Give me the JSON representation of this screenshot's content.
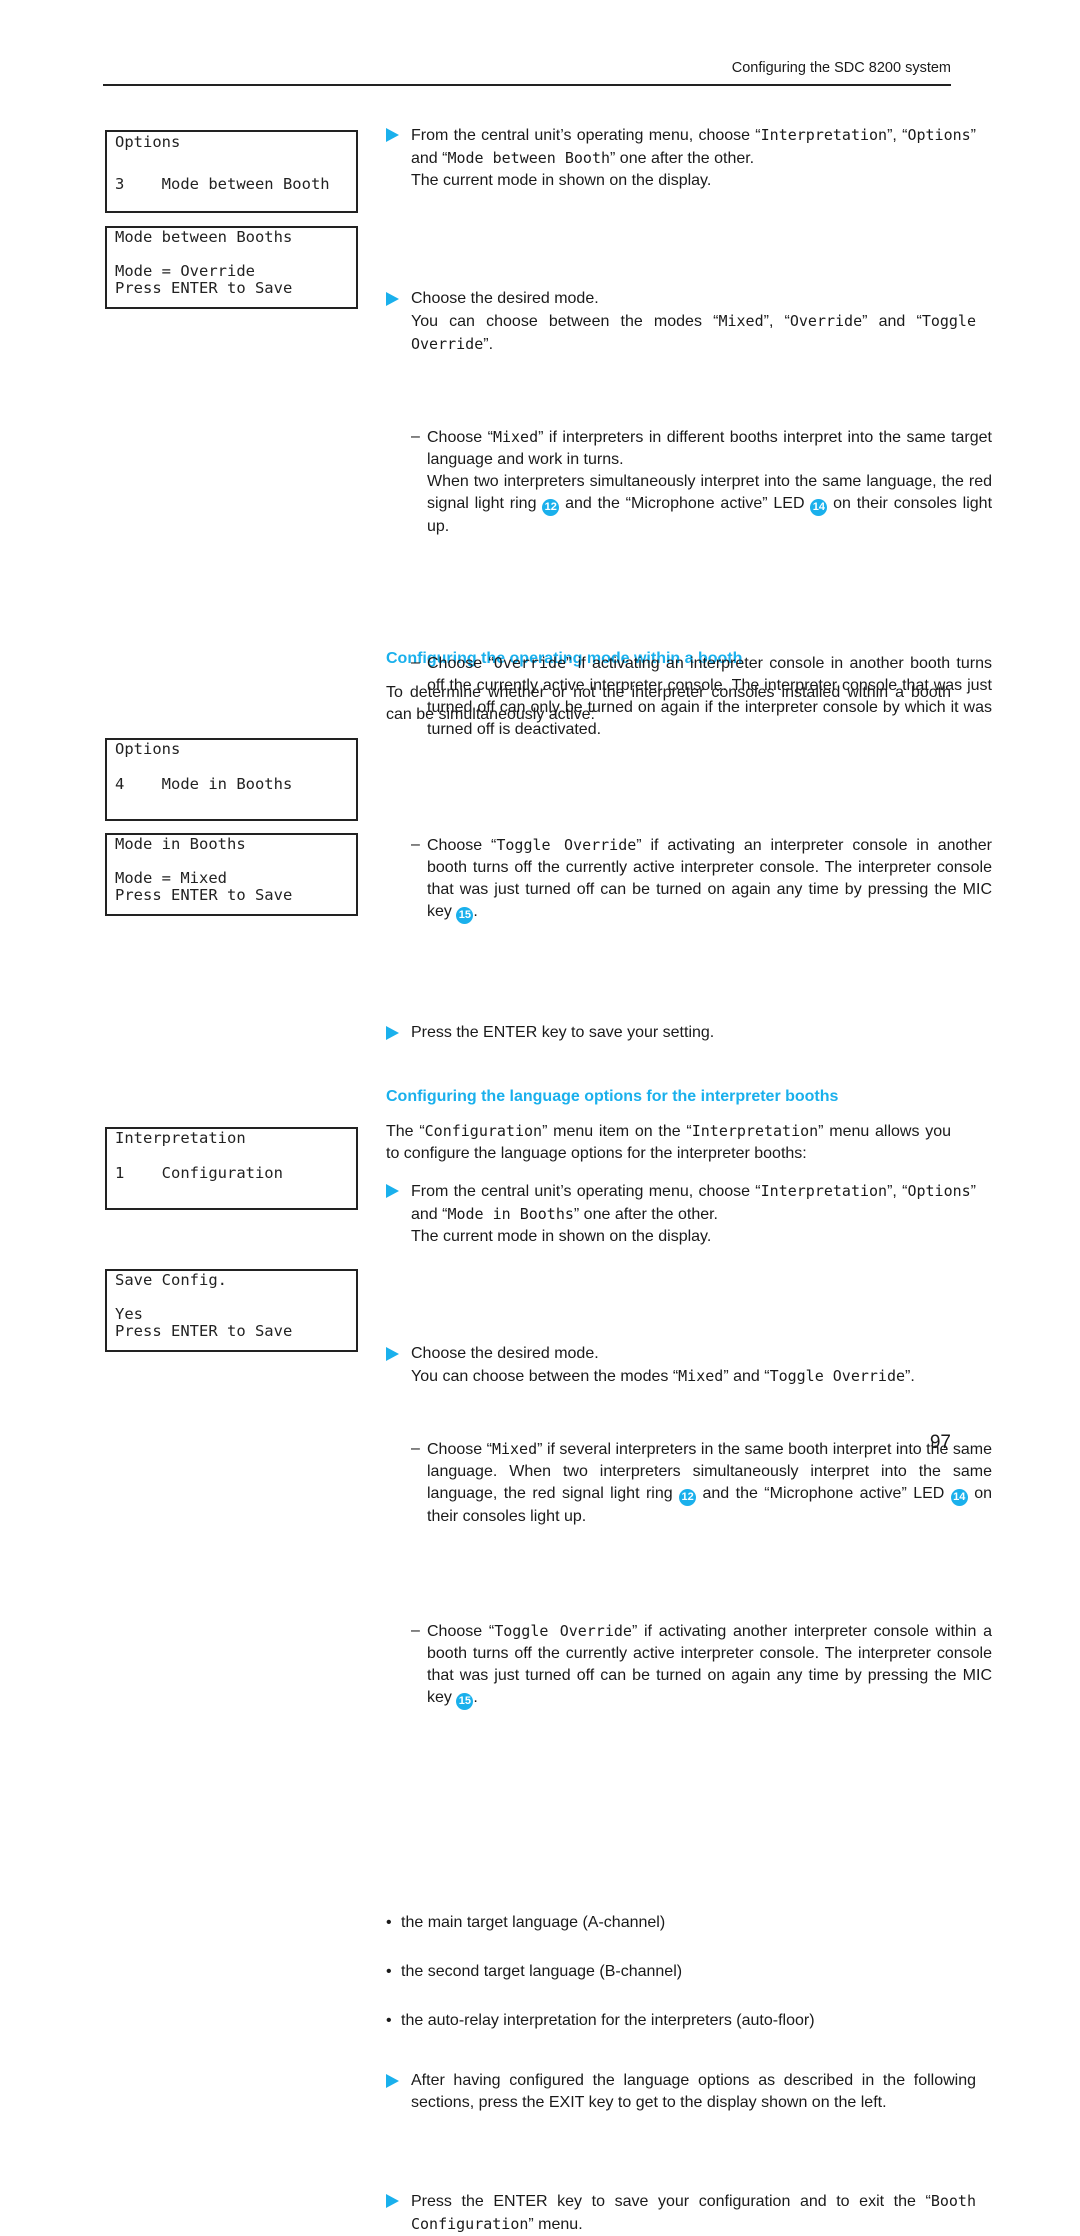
{
  "header": {
    "title": "Configuring the SDC 8200 system"
  },
  "page_number": "97",
  "colors": {
    "accent": "#1ab0ec"
  },
  "displays": [
    {
      "lines": [
        "Options",
        "3    Mode between Booth"
      ]
    },
    {
      "lines": [
        "Mode between Booths",
        "Mode = Override",
        "Press ENTER to Save"
      ]
    },
    {
      "lines": [
        "Options",
        "4    Mode in Booths"
      ]
    },
    {
      "lines": [
        "Mode in Booths",
        "Mode = Mixed",
        "Press ENTER to Save"
      ]
    },
    {
      "lines": [
        "Interpretation",
        "1    Configuration"
      ]
    },
    {
      "lines": [
        "Save Config.",
        "Yes",
        "Press ENTER to Save"
      ]
    }
  ],
  "headings": [
    "Configuring the operating mode within a booth",
    "Configuring the language options for the interpreter booths"
  ],
  "blocks": [
    {
      "type": "step",
      "content": [
        "From the central unit’s operating menu, choose “",
        {
          "m": "Interpretation"
        },
        "”, “",
        {
          "m": "Options"
        },
        "” and “",
        {
          "m": "Mode between Booth"
        },
        "” one after the other.\nThe current mode in shown on the display."
      ]
    },
    {
      "type": "step",
      "content": [
        "Choose the desired mode.\nYou can choose between the modes “",
        {
          "m": "Mixed"
        },
        "”, “",
        {
          "m": "Override"
        },
        "” and “",
        {
          "m": "Toggle Override"
        },
        "”."
      ]
    },
    {
      "type": "dash",
      "content": [
        "Choose “",
        {
          "m": "Mixed"
        },
        "” if interpreters in different booths interpret into the same target language and work in turns.\nWhen two interpreters simultaneously interpret into the same language, the red signal light ring ",
        {
          "r": "12"
        },
        " and the “Microphone active” LED ",
        {
          "r": "14"
        },
        " on their consoles light up."
      ]
    },
    {
      "type": "dash",
      "content": [
        "Choose “",
        {
          "m": "Override"
        },
        "” if activating an interpreter console in another booth turns off the currently active interpreter console. The interpreter console that was just turned off can only be turned on again if the interpreter console by which it was turned off is deactivated."
      ]
    },
    {
      "type": "dash",
      "content": [
        "Choose “",
        {
          "m": "Toggle Override"
        },
        "” if activating an interpreter console in another booth turns off the currently active interpreter console. The interpreter console that was just turned off can be turned on again any time by pressing the MIC key ",
        {
          "r": "15"
        },
        "."
      ]
    },
    {
      "type": "step",
      "content": [
        "Press the ENTER key to save your setting."
      ]
    },
    {
      "type": "para",
      "content": [
        "To determine whether or not the interpreter consoles installed within a booth can be simultaneously active:"
      ]
    },
    {
      "type": "step",
      "content": [
        "From the central unit’s operating menu, choose “",
        {
          "m": "Interpretation"
        },
        "”, “",
        {
          "m": "Options"
        },
        "” and “",
        {
          "m": "Mode in Booths"
        },
        "” one after the other.\nThe current mode in shown on the display."
      ]
    },
    {
      "type": "step",
      "content": [
        "Choose the desired mode.\nYou can choose between the modes “",
        {
          "m": "Mixed"
        },
        "” and “",
        {
          "m": "Toggle Override"
        },
        "”."
      ]
    },
    {
      "type": "dash",
      "content": [
        "Choose “",
        {
          "m": "Mixed"
        },
        "” if several interpreters in the same booth interpret into the same language. When two interpreters simultaneously interpret into the same language, the red signal light ring ",
        {
          "r": "12"
        },
        " and the “Microphone active” LED ",
        {
          "r": "14"
        },
        " on their consoles light up."
      ]
    },
    {
      "type": "dash",
      "content": [
        "Choose “",
        {
          "m": "Toggle Override"
        },
        "” if activating another interpreter console within a booth turns off the currently active interpreter console. The interpreter console that was just turned off can be turned on again any time by pressing the MIC key ",
        {
          "r": "15"
        },
        "."
      ]
    },
    {
      "type": "para",
      "content": [
        "The “",
        {
          "m": "Configuration"
        },
        "” menu item on the “",
        {
          "m": "Interpretation"
        },
        "” menu allows you to configure the language options for the interpreter booths:"
      ]
    },
    {
      "type": "bullet",
      "content": [
        "the main target language (A-channel)"
      ]
    },
    {
      "type": "bullet",
      "content": [
        "the second target language (B-channel)"
      ]
    },
    {
      "type": "bullet",
      "content": [
        "the auto-relay interpretation for the interpreters (auto-floor)"
      ]
    },
    {
      "type": "step",
      "content": [
        "After having configured the language options as described in the following sections, press the EXIT key to get to the display shown on the left."
      ]
    },
    {
      "type": "step",
      "content": [
        "Press the ENTER key to save your configuration and to exit the “",
        {
          "m": "Booth Configuration"
        },
        "” menu."
      ]
    }
  ]
}
